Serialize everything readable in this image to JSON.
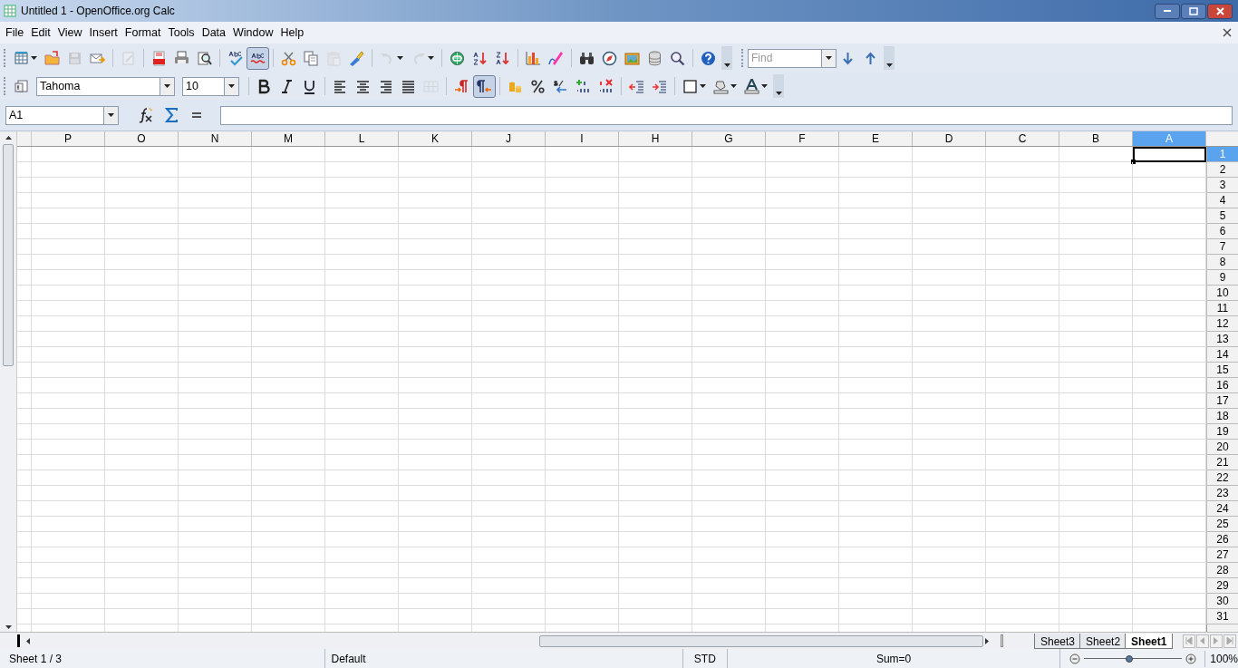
{
  "window": {
    "title": "Untitled 1 - OpenOffice.org Calc"
  },
  "menu": [
    "File",
    "Edit",
    "View",
    "Insert",
    "Format",
    "Tools",
    "Data",
    "Window",
    "Help"
  ],
  "standard_toolbar": [
    {
      "kind": "button",
      "disabled": false,
      "pressed": false
    },
    {
      "kind": "button",
      "disabled": false,
      "pressed": false
    },
    {
      "kind": "button",
      "disabled": true,
      "pressed": false
    },
    {
      "kind": "button",
      "disabled": false,
      "pressed": false
    },
    {
      "kind": "separator"
    },
    {
      "kind": "button",
      "disabled": true,
      "pressed": false
    },
    {
      "kind": "separator"
    },
    {
      "kind": "button",
      "disabled": false,
      "pressed": false
    },
    {
      "kind": "button",
      "disabled": false,
      "pressed": false
    },
    {
      "kind": "button",
      "disabled": false,
      "pressed": false
    },
    {
      "kind": "separator"
    },
    {
      "kind": "button",
      "disabled": false
    },
    {
      "kind": "toggle",
      "disabled": false,
      "pressed": true
    },
    {
      "kind": "separator"
    },
    {
      "kind": "button",
      "disabled": false,
      "pressed": false
    },
    {
      "kind": "button",
      "disabled": false,
      "pressed": false
    },
    {
      "kind": "button",
      "disabled": true,
      "pressed": false
    },
    {
      "kind": "button",
      "disabled": false,
      "pressed": false
    },
    {
      "kind": "separator"
    },
    {
      "kind": "button",
      "disabled": true,
      "pressed": false
    },
    {
      "kind": "button",
      "disabled": true,
      "pressed": false
    },
    {
      "kind": "separator"
    },
    {
      "kind": "button",
      "disabled": false,
      "pressed": false
    },
    {
      "kind": "button",
      "disabled": false,
      "pressed": false
    },
    {
      "kind": "button",
      "disabled": false,
      "pressed": false
    },
    {
      "kind": "separator"
    },
    {
      "kind": "button",
      "disabled": false,
      "pressed": false
    },
    {
      "kind": "button",
      "disabled": false,
      "pressed": false
    },
    {
      "kind": "separator"
    },
    {
      "kind": "button",
      "disabled": false,
      "pressed": false
    },
    {
      "kind": "button",
      "disabled": false,
      "pressed": false
    },
    {
      "kind": "button",
      "disabled": false,
      "pressed": false
    },
    {
      "kind": "button",
      "disabled": false,
      "pressed": false
    },
    {
      "kind": "button",
      "disabled": false,
      "pressed": false
    },
    {
      "kind": "separator"
    },
    {
      "kind": "button",
      "disabled": false,
      "pressed": false
    }
  ],
  "find_toolbar": {
    "placeholder": "Find"
  },
  "formatting_toolbar": {
    "font_name": "Tahoma",
    "font_size": "10",
    "buttons": [
      {
        "kind": "button",
        "disabled": false,
        "pressed": false
      },
      {
        "kind": "separator"
      },
      {
        "kind": "button",
        "disabled": false,
        "pressed": false
      },
      {
        "kind": "button",
        "disabled": false,
        "pressed": false
      },
      {
        "kind": "button",
        "disabled": false,
        "pressed": false
      },
      {
        "kind": "separator"
      },
      {
        "kind": "button",
        "disabled": false,
        "pressed": false
      },
      {
        "kind": "button",
        "disabled": false,
        "pressed": false
      },
      {
        "kind": "button",
        "disabled": false,
        "pressed": false
      },
      {
        "kind": "button",
        "disabled": false,
        "pressed": false
      },
      {
        "kind": "button",
        "disabled": true,
        "pressed": false
      },
      {
        "kind": "separator"
      },
      {
        "kind": "button",
        "disabled": false,
        "pressed": false
      },
      {
        "kind": "button",
        "disabled": false,
        "pressed": true
      },
      {
        "kind": "separator"
      },
      {
        "kind": "button",
        "disabled": false,
        "pressed": false
      },
      {
        "kind": "button",
        "disabled": false,
        "pressed": false
      },
      {
        "kind": "button",
        "disabled": false,
        "pressed": false
      },
      {
        "kind": "button",
        "disabled": false,
        "pressed": false
      },
      {
        "kind": "button",
        "disabled": false,
        "pressed": false
      },
      {
        "kind": "separator"
      },
      {
        "kind": "button",
        "disabled": false,
        "pressed": false
      },
      {
        "kind": "button",
        "disabled": false,
        "pressed": false
      },
      {
        "kind": "separator"
      },
      {
        "kind": "button",
        "disabled": false,
        "pressed": false
      },
      {
        "kind": "button",
        "disabled": false,
        "pressed": false
      },
      {
        "kind": "button",
        "disabled": false,
        "pressed": false
      }
    ]
  },
  "formula_bar": {
    "name_box": "A1"
  },
  "columns": [
    {
      "label": "P",
      "selected": false
    },
    {
      "label": "O",
      "selected": false
    },
    {
      "label": "N",
      "selected": false
    },
    {
      "label": "M",
      "selected": false
    },
    {
      "label": "L",
      "selected": false
    },
    {
      "label": "K",
      "selected": false
    },
    {
      "label": "J",
      "selected": false
    },
    {
      "label": "I",
      "selected": false
    },
    {
      "label": "H",
      "selected": false
    },
    {
      "label": "G",
      "selected": false
    },
    {
      "label": "F",
      "selected": false
    },
    {
      "label": "E",
      "selected": false
    },
    {
      "label": "D",
      "selected": false
    },
    {
      "label": "C",
      "selected": false
    },
    {
      "label": "B",
      "selected": false
    },
    {
      "label": "A",
      "selected": true
    }
  ],
  "rows": [
    {
      "label": "1",
      "selected": true
    },
    {
      "label": "2",
      "selected": false
    },
    {
      "label": "3",
      "selected": false
    },
    {
      "label": "4",
      "selected": false
    },
    {
      "label": "5",
      "selected": false
    },
    {
      "label": "6",
      "selected": false
    },
    {
      "label": "7",
      "selected": false
    },
    {
      "label": "8",
      "selected": false
    },
    {
      "label": "9",
      "selected": false
    },
    {
      "label": "10",
      "selected": false
    },
    {
      "label": "11",
      "selected": false
    },
    {
      "label": "12",
      "selected": false
    },
    {
      "label": "13",
      "selected": false
    },
    {
      "label": "14",
      "selected": false
    },
    {
      "label": "15",
      "selected": false
    },
    {
      "label": "16",
      "selected": false
    },
    {
      "label": "17",
      "selected": false
    },
    {
      "label": "18",
      "selected": false
    },
    {
      "label": "19",
      "selected": false
    },
    {
      "label": "20",
      "selected": false
    },
    {
      "label": "21",
      "selected": false
    },
    {
      "label": "22",
      "selected": false
    },
    {
      "label": "23",
      "selected": false
    },
    {
      "label": "24",
      "selected": false
    },
    {
      "label": "25",
      "selected": false
    },
    {
      "label": "26",
      "selected": false
    },
    {
      "label": "27",
      "selected": false
    },
    {
      "label": "28",
      "selected": false
    },
    {
      "label": "29",
      "selected": false
    },
    {
      "label": "30",
      "selected": false
    },
    {
      "label": "31",
      "selected": false
    }
  ],
  "sheet_tabs": [
    {
      "label": "Sheet3",
      "selected": false
    },
    {
      "label": "Sheet2",
      "selected": false
    },
    {
      "label": "Sheet1",
      "selected": true
    }
  ],
  "status_bar": {
    "sheet": "Sheet 1 / 3",
    "page_style": "Default",
    "selection_mode": "STD",
    "sum": "Sum=0",
    "zoom": {
      "level": 0.46,
      "reading": "100%"
    }
  }
}
